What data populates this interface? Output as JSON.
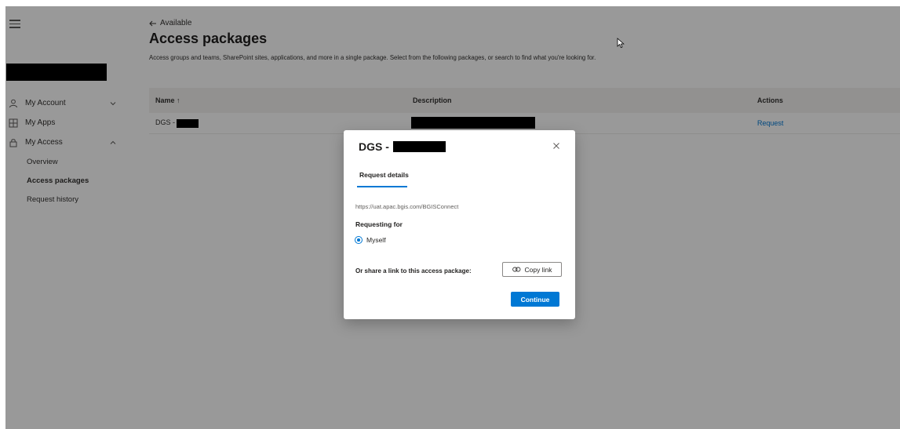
{
  "sidebar": {
    "nav": [
      {
        "label": "My Account",
        "icon": "person-icon",
        "chevron": "chevron-down-icon"
      },
      {
        "label": "My Apps",
        "icon": "apps-grid-icon"
      },
      {
        "label": "My Access",
        "icon": "lock-icon",
        "chevron": "chevron-up-icon"
      }
    ],
    "sub": [
      {
        "label": "Overview"
      },
      {
        "label": "Access packages",
        "active": true
      },
      {
        "label": "Request history"
      }
    ]
  },
  "main": {
    "back_label": "Available",
    "title": "Access packages",
    "description": "Access groups and teams, SharePoint sites, applications, and more in a single package. Select from the following packages, or search to find what you're looking for.",
    "table": {
      "headers": {
        "name": "Name",
        "name_sort": "↑",
        "description": "Description",
        "actions": "Actions"
      },
      "rows": [
        {
          "name_prefix": "DGS -",
          "action": "Request"
        }
      ]
    }
  },
  "dialog": {
    "title_prefix": "DGS -",
    "tab": "Request details",
    "url": "https://uat.apac.bgis.com/BGISConnect",
    "requesting_for_label": "Requesting for",
    "option": "Myself",
    "share_label": "Or share a link to this access package:",
    "copy_link": "Copy link",
    "continue": "Continue"
  },
  "colors": {
    "accent": "#0078d4",
    "overlay": "rgba(0,0,0,0.40)"
  }
}
